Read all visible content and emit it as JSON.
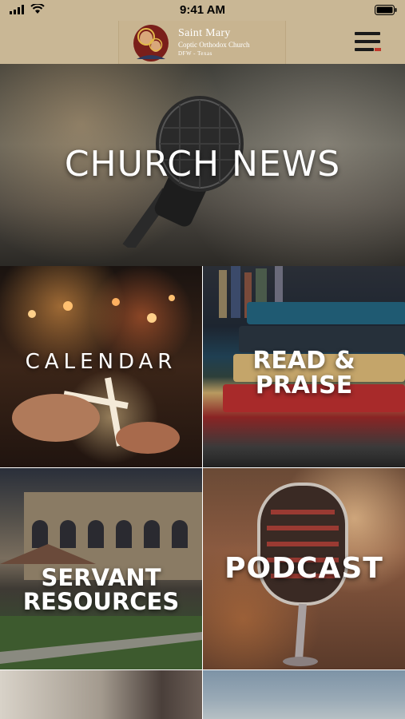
{
  "status_bar": {
    "time": "9:41 AM",
    "icons": [
      "signal-icon",
      "wifi-icon",
      "battery-icon"
    ]
  },
  "header": {
    "title": "Saint Mary",
    "subtitle": "Coptic Orthodox Church",
    "location": "DFW - Texas",
    "logo": "icon-logo",
    "menu_icon": "hamburger-menu-icon"
  },
  "tiles": [
    {
      "id": "church-news",
      "label": "CHURCH NEWS"
    },
    {
      "id": "calendar",
      "label": "CALENDAR"
    },
    {
      "id": "read-praise",
      "label_line1": "READ &",
      "label_line2": "PRAISE"
    },
    {
      "id": "servant-resources",
      "label_line1": "SERVANT",
      "label_line2": "RESOURCES"
    },
    {
      "id": "podcast",
      "label": "PODCAST"
    }
  ],
  "colors": {
    "header_bg": "#c9b795",
    "tile_text": "#ffffff",
    "menu_accent": "#c0392b"
  }
}
